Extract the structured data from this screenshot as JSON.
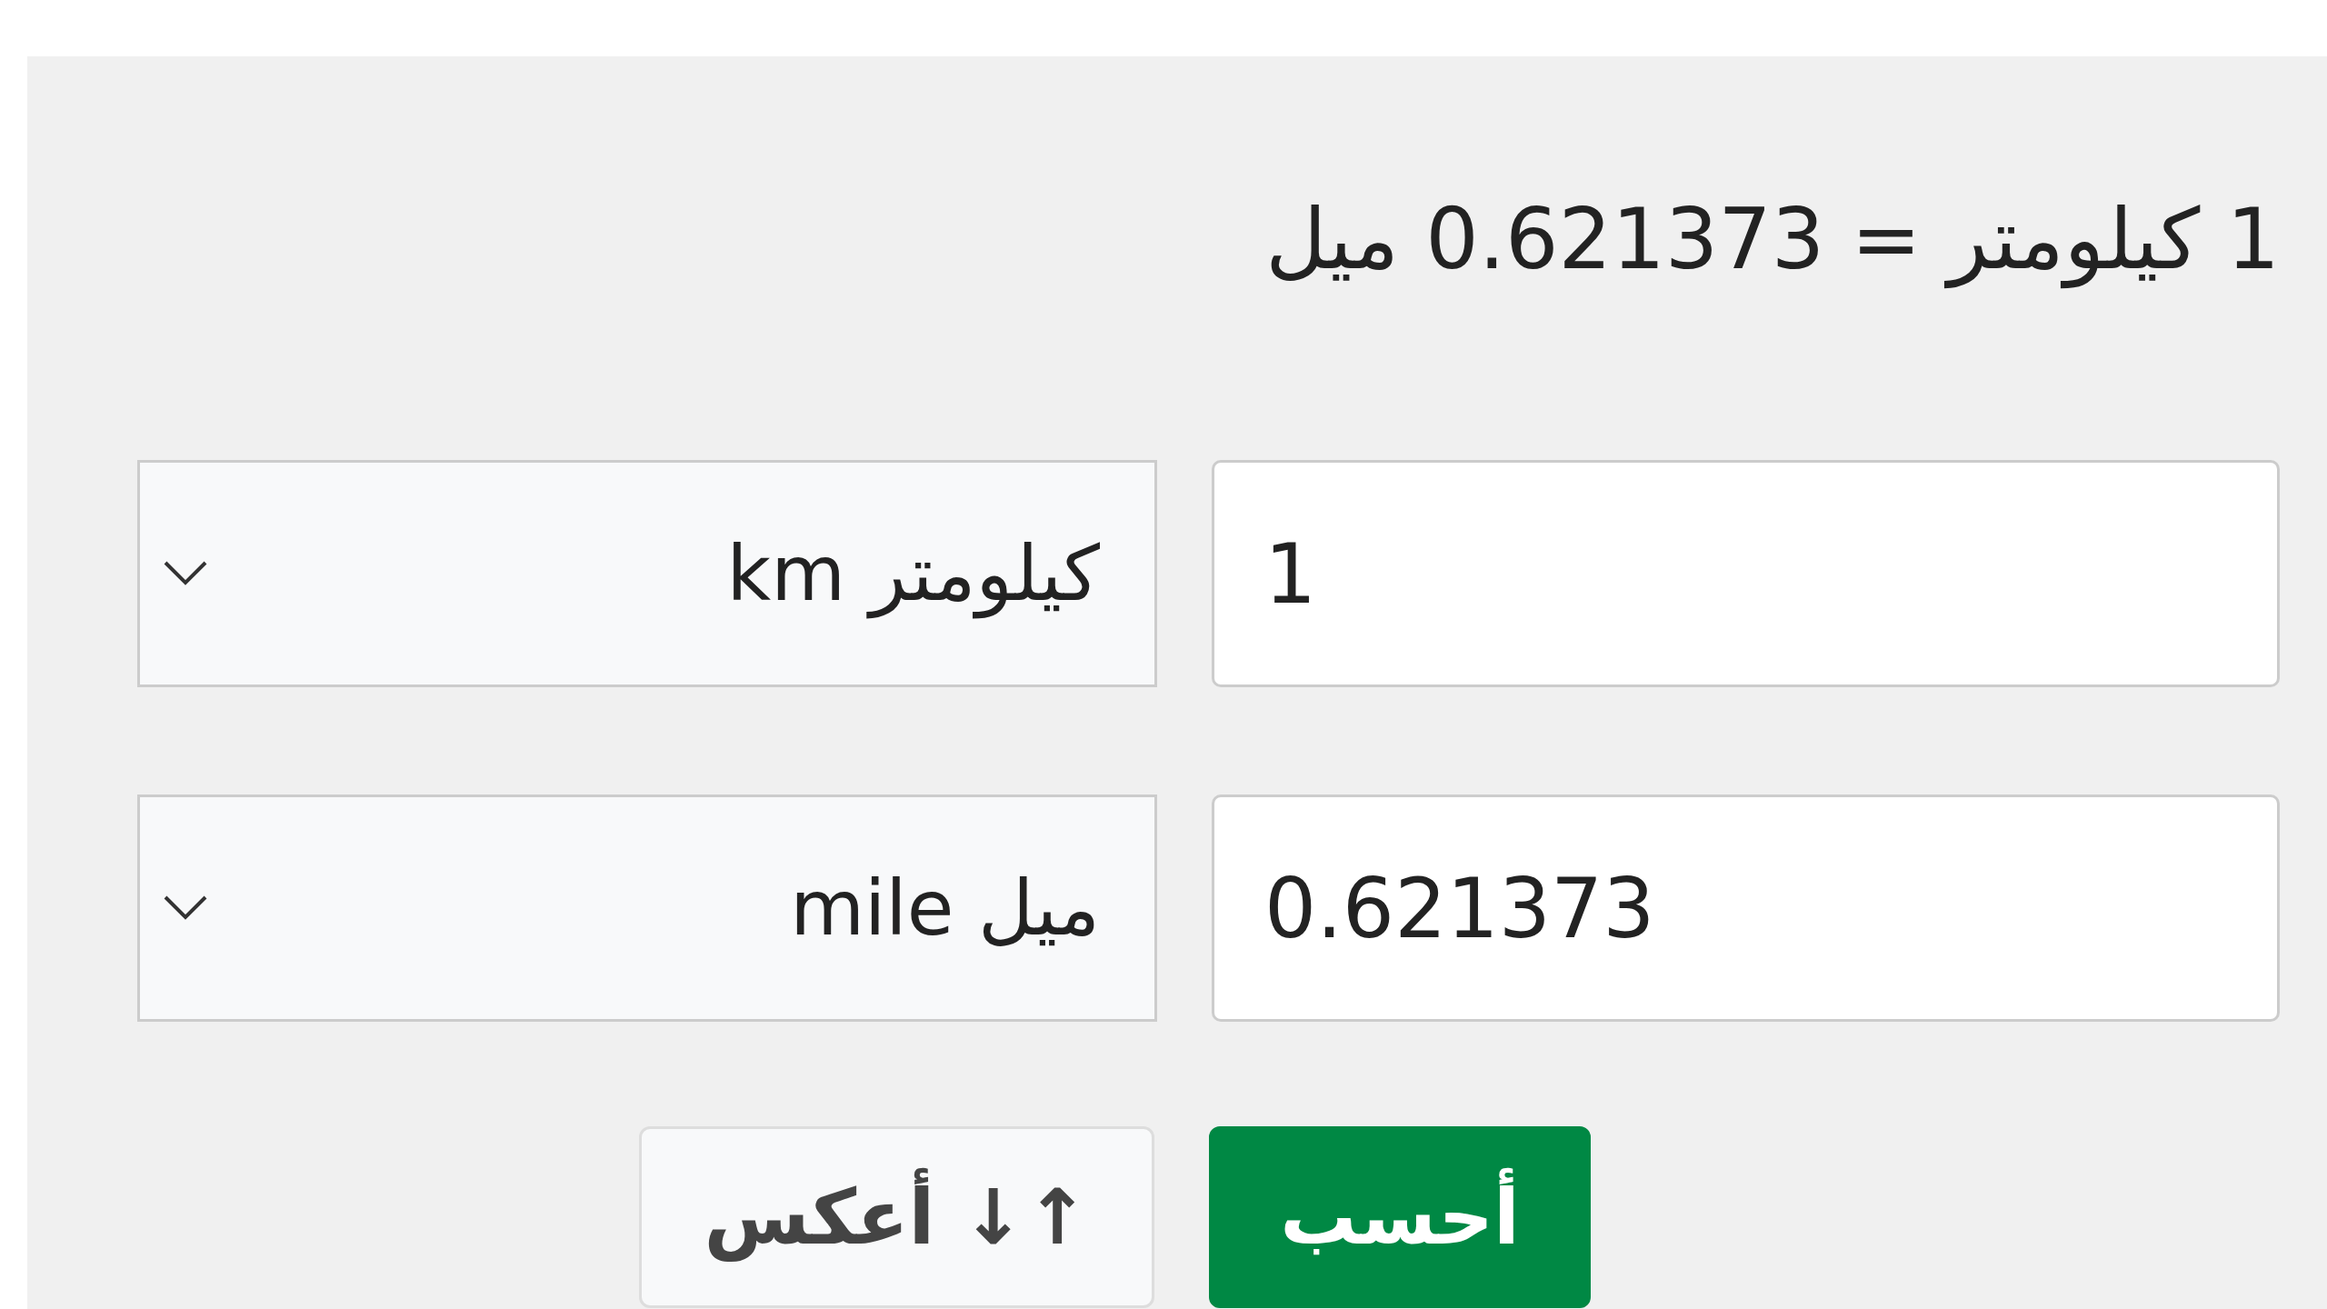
{
  "result": "1 كيلومتر = 0.621373 ميل",
  "rows": [
    {
      "value": "1",
      "unit": "كيلومتر km"
    },
    {
      "value": "0.621373",
      "unit": "ميل mile"
    }
  ],
  "buttons": [
    {
      "label": "أحسب",
      "kind": "primary"
    },
    {
      "label": "↑↓ أعكس",
      "kind": "secondary"
    }
  ]
}
